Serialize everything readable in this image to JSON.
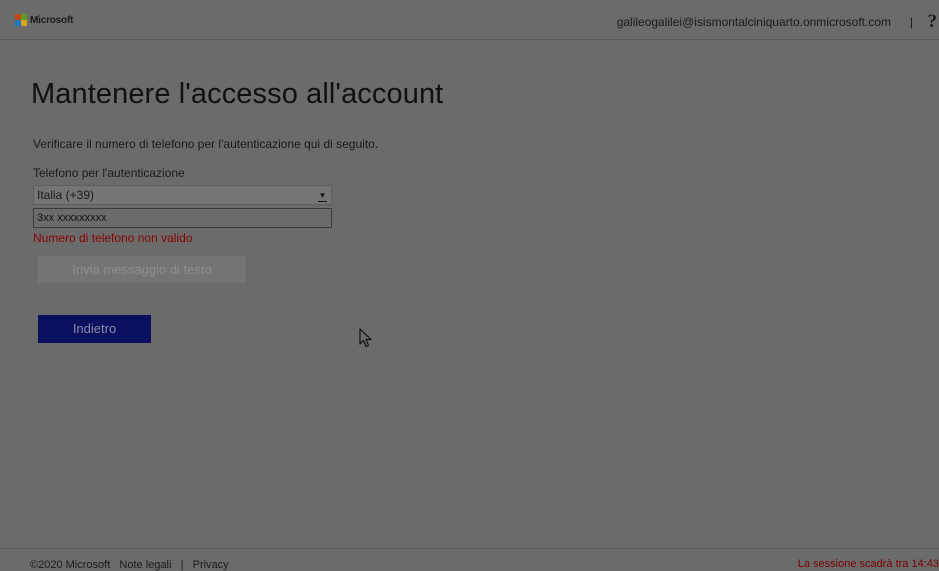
{
  "header": {
    "brand": "Microsoft",
    "account": "galileogalilei@isismontalciniquarto.onmicrosoft.com",
    "separator": "|",
    "help": "?",
    "logo_colors": [
      "#c8451a",
      "#5e9d1f",
      "#1a78c2",
      "#d6a31a"
    ]
  },
  "main": {
    "title": "Mantenere l'accesso all'account",
    "description": "Verificare il numero di telefono per l'autenticazione qui di seguito.",
    "phone_label": "Telefono per l'autenticazione",
    "country_select": "Italia (+39)",
    "phone_value": "3xx xxxxxxxxx",
    "error": "Numero di telefono non valido",
    "send_button": "Invia messaggio di testo",
    "back_button": "Indietro"
  },
  "footer": {
    "copyright": "©2020 Microsoft",
    "legal": "Note legali",
    "separator": "|",
    "privacy": "Privacy",
    "session": "La sessione scadrà tra 14:43"
  }
}
